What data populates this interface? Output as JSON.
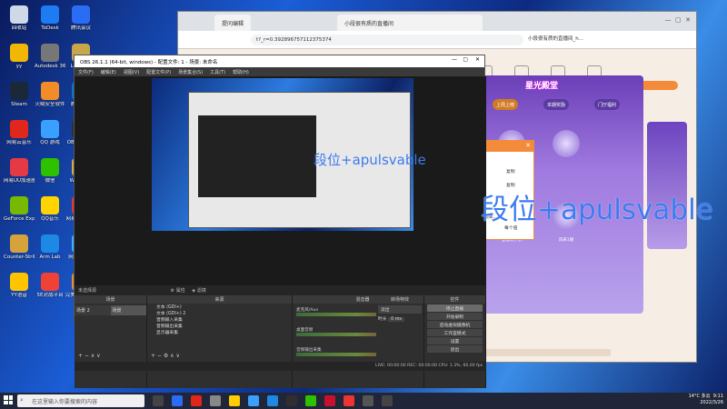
{
  "desktop": {
    "icons": [
      {
        "label": "回收站",
        "color": "#cfd8e6"
      },
      {
        "label": "ToDesk",
        "color": "#1d7cf2"
      },
      {
        "label": "腾讯会议",
        "color": "#2a6df4"
      },
      {
        "label": "yy",
        "color": "#f2b705"
      },
      {
        "label": "Autodesk 360",
        "color": "#777"
      },
      {
        "label": "Legends",
        "color": "#c8a64a"
      },
      {
        "label": "Steam",
        "color": "#1b2838"
      },
      {
        "label": "火绒安全软件",
        "color": "#f28c28"
      },
      {
        "label": "腾讯游戏",
        "color": "#0d75c8"
      },
      {
        "label": "网易云音乐",
        "color": "#e1261c"
      },
      {
        "label": "QQ 游戏",
        "color": "#3aa0ff"
      },
      {
        "label": "OBS Studio",
        "color": "#302e31"
      },
      {
        "label": "网易UU加速器",
        "color": "#e63946"
      },
      {
        "label": "微信",
        "color": "#2dc100"
      },
      {
        "label": "WeGame",
        "color": "#d7ab3f"
      },
      {
        "label": "GeForce Experience",
        "color": "#76b900"
      },
      {
        "label": "QQ音乐",
        "color": "#ffd400"
      },
      {
        "label": "网易有道翻译",
        "color": "#e33"
      },
      {
        "label": "Counter-Strike",
        "color": "#d6a23b"
      },
      {
        "label": "Arm Lab",
        "color": "#1e88e5"
      },
      {
        "label": "网易MuMu",
        "color": "#3cb1ff"
      },
      {
        "label": "YY语音",
        "color": "#ffc400"
      },
      {
        "label": "5E对战平台",
        "color": "#ef4136"
      },
      {
        "label": "完美世界竞技平台",
        "color": "#f28c28"
      }
    ]
  },
  "browser": {
    "tab1": "提问编辑",
    "tab2": "小段很有质的直播间",
    "url": "t?_r=0.392896757112375374",
    "page_tab": "小段很有质的直播间_h...",
    "game_title": "星光殿堂",
    "game_tabs": [
      "上周上榜",
      "本期奖励",
      "门厅福利"
    ],
    "chest_labels": [
      "全能玩手机",
      "风采1朋"
    ],
    "dialog_lines": [
      "复制",
      "复制",
      "帧率...",
      "每个值"
    ]
  },
  "obs": {
    "title": "OBS 26.1.1 (64-bit, windows) - 配置文件: 1 - 场景: 未命名",
    "menu": [
      "文件(F)",
      "编辑(E)",
      "视图(V)",
      "配置文件(P)",
      "场景集合(S)",
      "工具(T)",
      "帮助(H)"
    ],
    "scene_label": "未选择源",
    "scene_buttons": [
      "属性",
      "滤镜"
    ],
    "docks": {
      "scenes": {
        "title": "场景",
        "items": [
          "场景 2",
          "场景"
        ]
      },
      "sources": {
        "title": "来源",
        "items": [
          "文本 (GDI+)",
          "文本 (GDI+) 2",
          "音频输入采集",
          "音频输出采集",
          "显示器采集"
        ]
      },
      "mixer": {
        "title": "混音器",
        "channels": [
          {
            "name": "麦克风/Aux",
            "db": "-4.7 dB"
          },
          {
            "name": "桌面音频",
            "db": "0.0 dB"
          },
          {
            "name": "音频输出采集",
            "db": "0.0 dB"
          }
        ]
      },
      "transitions": {
        "title": "转场特效",
        "type": "淡出",
        "duration_label": "时长",
        "duration": "0 ms"
      },
      "controls": {
        "title": "控件",
        "buttons": [
          "停止直播",
          "开始录制",
          "启动虚拟摄像机",
          "工作室模式",
          "设置",
          "退出"
        ]
      }
    },
    "status": "LIVE: 00:00:00   REC: 00:00:00   CPU: 1.3%, 60.00 fps"
  },
  "overlay": {
    "big": "段位+apulsvable",
    "small": "段位+apulsvable"
  },
  "taskbar": {
    "search_placeholder": "在这里输入你要搜索的内容",
    "weather": "14°C 多云",
    "time": "9:11",
    "date": "2022/3/26"
  }
}
